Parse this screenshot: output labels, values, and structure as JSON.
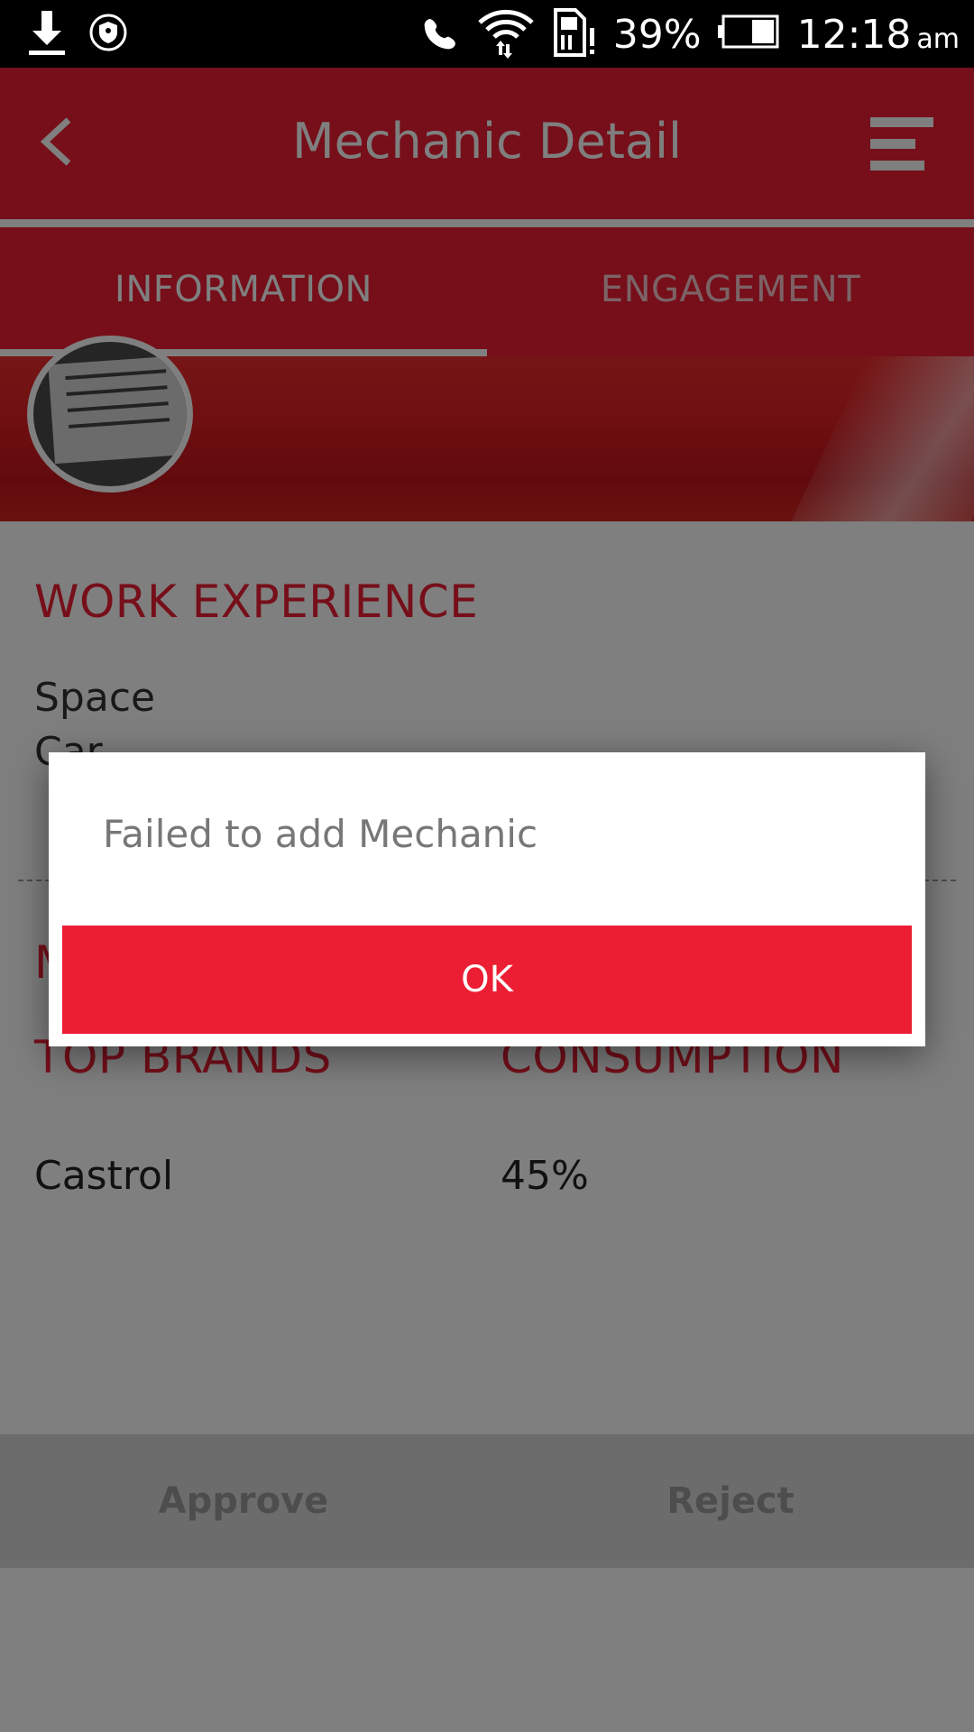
{
  "status_bar": {
    "battery": "39%",
    "time": "12:18",
    "ampm": "am",
    "icons": [
      "download-icon",
      "shield-icon",
      "phone-icon",
      "wifi-icon",
      "sim-icon",
      "battery-icon"
    ]
  },
  "toolbar": {
    "title": "Mechanic Detail",
    "back_icon": "chevron-left-icon",
    "menu_icon": "menu-icon"
  },
  "tabs": [
    {
      "label": "INFORMATION",
      "active": true
    },
    {
      "label": "ENGAGEMENT",
      "active": false
    }
  ],
  "work_experience": {
    "title": "WORK EXPERIENCE",
    "line1": "Space",
    "line2": "Car"
  },
  "brands_section": {
    "partial_title": "M",
    "col1_header": "TOP BRANDS",
    "col2_header": "CONSUMPTION",
    "rows": [
      {
        "brand": "Castrol",
        "consumption": "45%"
      }
    ]
  },
  "actions": {
    "approve": "Approve",
    "reject": "Reject"
  },
  "dialog": {
    "message": "Failed to add Mechanic",
    "ok_label": "OK"
  },
  "colors": {
    "primary": "#ec1e34",
    "scrim": "rgba(0,0,0,0.5)"
  }
}
